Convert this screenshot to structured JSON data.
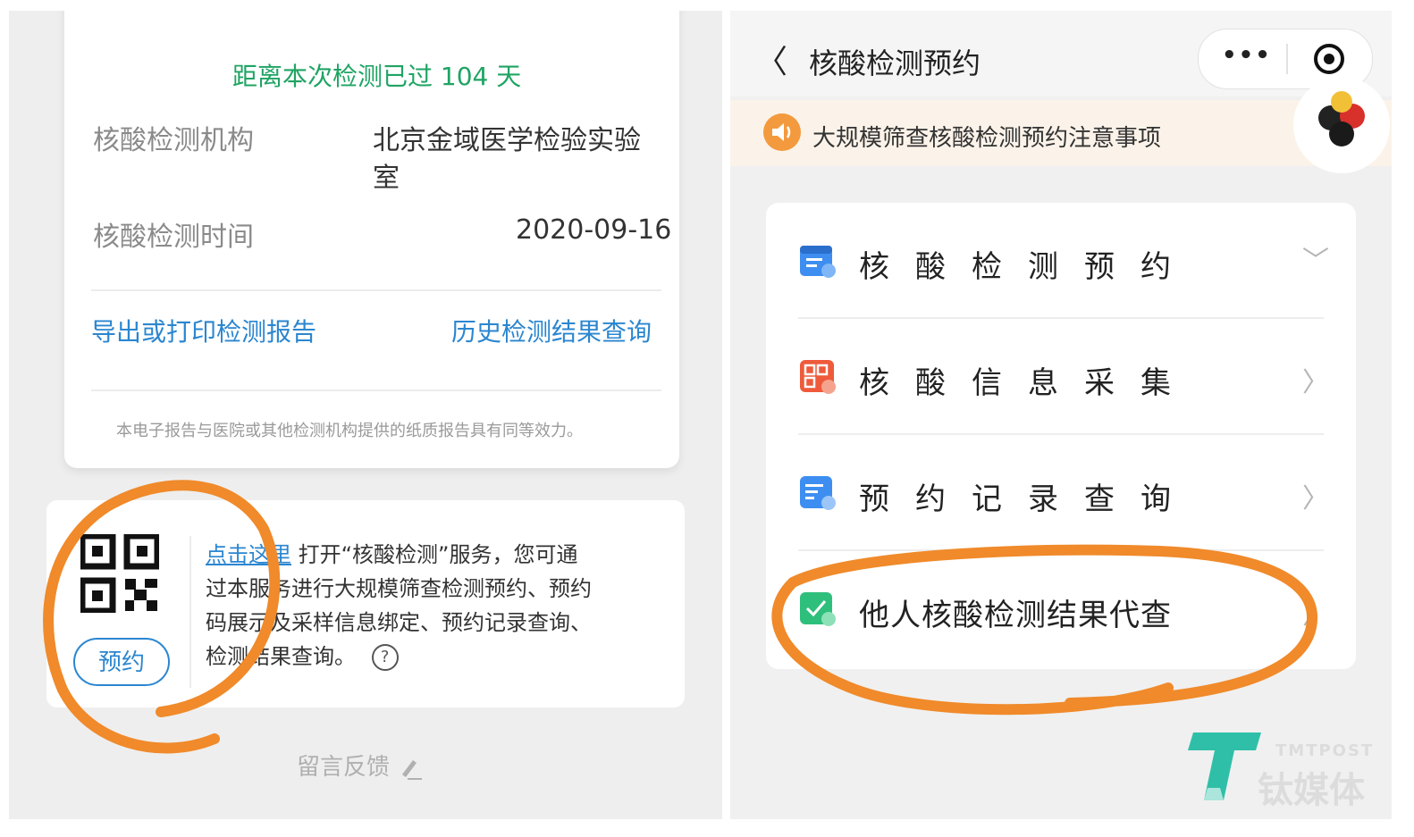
{
  "left": {
    "days_since": "距离本次检测已过 104 天",
    "institution_label": "核酸检测机构",
    "institution_value_line1": "北京金域医学检验实验",
    "institution_value_line2": "室",
    "time_label": "核酸检测时间",
    "time_value": "2020-09-16",
    "export_link": "导出或打印检测报告",
    "history_link": "历史检测结果查询",
    "disclaimer": "本电子报告与医院或其他检测机构提供的纸质报告具有同等效力。",
    "click_here": "点击这里",
    "service_desc_1": " 打开“核酸检测”服务，您可通",
    "service_desc_2": "过本服务进行大规模筛查检测预约、预约",
    "service_desc_3": "码展示及采样信息绑定、预约记录查询、",
    "service_desc_4": "检测结果查询。",
    "help_symbol": "?",
    "reserve_button": "预约",
    "feedback": "留言反馈"
  },
  "right": {
    "back_symbol": "〈",
    "title": "核酸检测预约",
    "more_symbol": "•••",
    "notice": "大规模筛查核酸检测预约注意事项",
    "menu": [
      {
        "label": "核酸检测预约",
        "arrow": "﹀"
      },
      {
        "label": "核酸信息采集",
        "arrow": "〉"
      },
      {
        "label": "预约记录查询",
        "arrow": "〉"
      },
      {
        "label": "他人核酸检测结果代查",
        "arrow": "〉"
      }
    ]
  },
  "watermark": {
    "en": "TMTPOST",
    "cn": "钛媒体"
  },
  "colors": {
    "annotation": "#f08a2a",
    "green": "#1fa463",
    "link": "#2b86d0"
  }
}
